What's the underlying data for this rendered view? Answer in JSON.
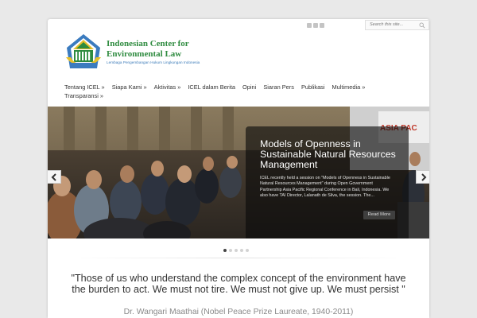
{
  "header": {
    "org_name": "Indonesian Center for Environmental Law",
    "tagline": "Lembaga Pengembangan Hukum Lingkungan Indonesia",
    "search": {
      "placeholder": "Search this site..."
    },
    "social_icons": [
      "twitter-icon",
      "facebook-icon",
      "rss-icon"
    ],
    "colors": {
      "brand_green": "#2e8b3f",
      "tagline_blue": "#3a7ab8"
    }
  },
  "nav": {
    "row1": [
      "Tentang ICEL »",
      "Siapa Kami »",
      "Aktivitas »",
      "ICEL dalam Berita",
      "Opini",
      "Siaran Pers",
      "Publikasi",
      "Multimedia »"
    ],
    "row2": [
      "Transparansi »"
    ]
  },
  "slider": {
    "title": "Models of Openness in Sustainable Natural Resources Management",
    "text": "ICEL recently held a session on \"Models of Openness in Sustainable Natural Resources Management\" during Open Government Partnership Asia Pacific Regional Conference in Bali, Indonesia. We also have TAI Director, Lalanath de Silva, the session. The...",
    "read_more": "Read More",
    "prev_icon": "chevron-left-icon",
    "next_icon": "chevron-right-icon",
    "banner_text": "ASIA PAC",
    "slide_count": 5,
    "active_slide": 1
  },
  "quote": {
    "text": "\"Those of us who understand the complex concept of the environment have the burden to act. We must not tire. We must not give up. We must persist \"",
    "author": "Dr. Wangari Maathai (Nobel Peace Prize Laureate, 1940-2011)"
  }
}
